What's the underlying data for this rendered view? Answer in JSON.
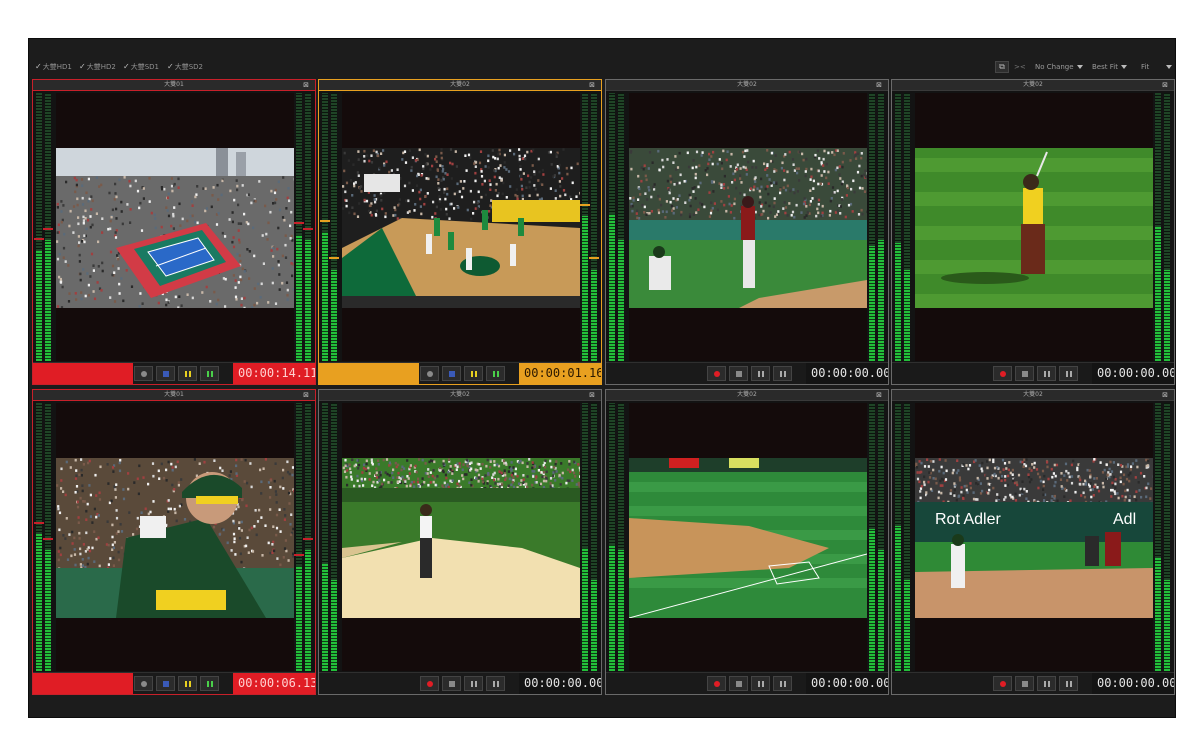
{
  "toolbar": {
    "sources": [
      {
        "label": "大雙HD1"
      },
      {
        "label": "大雙HD2"
      },
      {
        "label": "大雙SD1"
      },
      {
        "label": "大雙SD2"
      }
    ],
    "layout_button": "⧉",
    "compare_button": "><",
    "dropdown_1": "No Change",
    "dropdown_2": "Best Fit",
    "dropdown_3": "Fit"
  },
  "cells": [
    {
      "title": "大雙01",
      "timecode": "00:00:14.11",
      "state": "recording",
      "accent": "#c8202a",
      "scene": "tennis"
    },
    {
      "title": "大雙02",
      "timecode": "00:00:01.16",
      "state": "preview",
      "accent": "#e8a020",
      "scene": "basketball"
    },
    {
      "title": "大雙02",
      "timecode": "00:00:00.00",
      "state": "idle",
      "accent": "#6a6a6a",
      "scene": "baseball-batter"
    },
    {
      "title": "大雙02",
      "timecode": "00:00:00.00",
      "state": "idle",
      "accent": "#6a6a6a",
      "scene": "golf-swing"
    },
    {
      "title": "大雙01",
      "timecode": "00:00:06.13",
      "state": "recording",
      "accent": "#c8202a",
      "scene": "baseball-closeup"
    },
    {
      "title": "大雙02",
      "timecode": "00:00:00.00",
      "state": "idle",
      "accent": "#6a6a6a",
      "scene": "golf-bunker"
    },
    {
      "title": "大雙02",
      "timecode": "00:00:00.00",
      "state": "idle",
      "accent": "#6a6a6a",
      "scene": "baseball-field"
    },
    {
      "title": "大雙02",
      "timecode": "00:00:00.00",
      "state": "idle",
      "accent": "#6a6a6a",
      "scene": "baseball-pitch"
    }
  ],
  "ad_text": "Rot Adler",
  "colors": {
    "recording": "#e01d25",
    "preview": "#e8a020",
    "meter_green": "#23c03a",
    "background": "#1c1c1c"
  }
}
